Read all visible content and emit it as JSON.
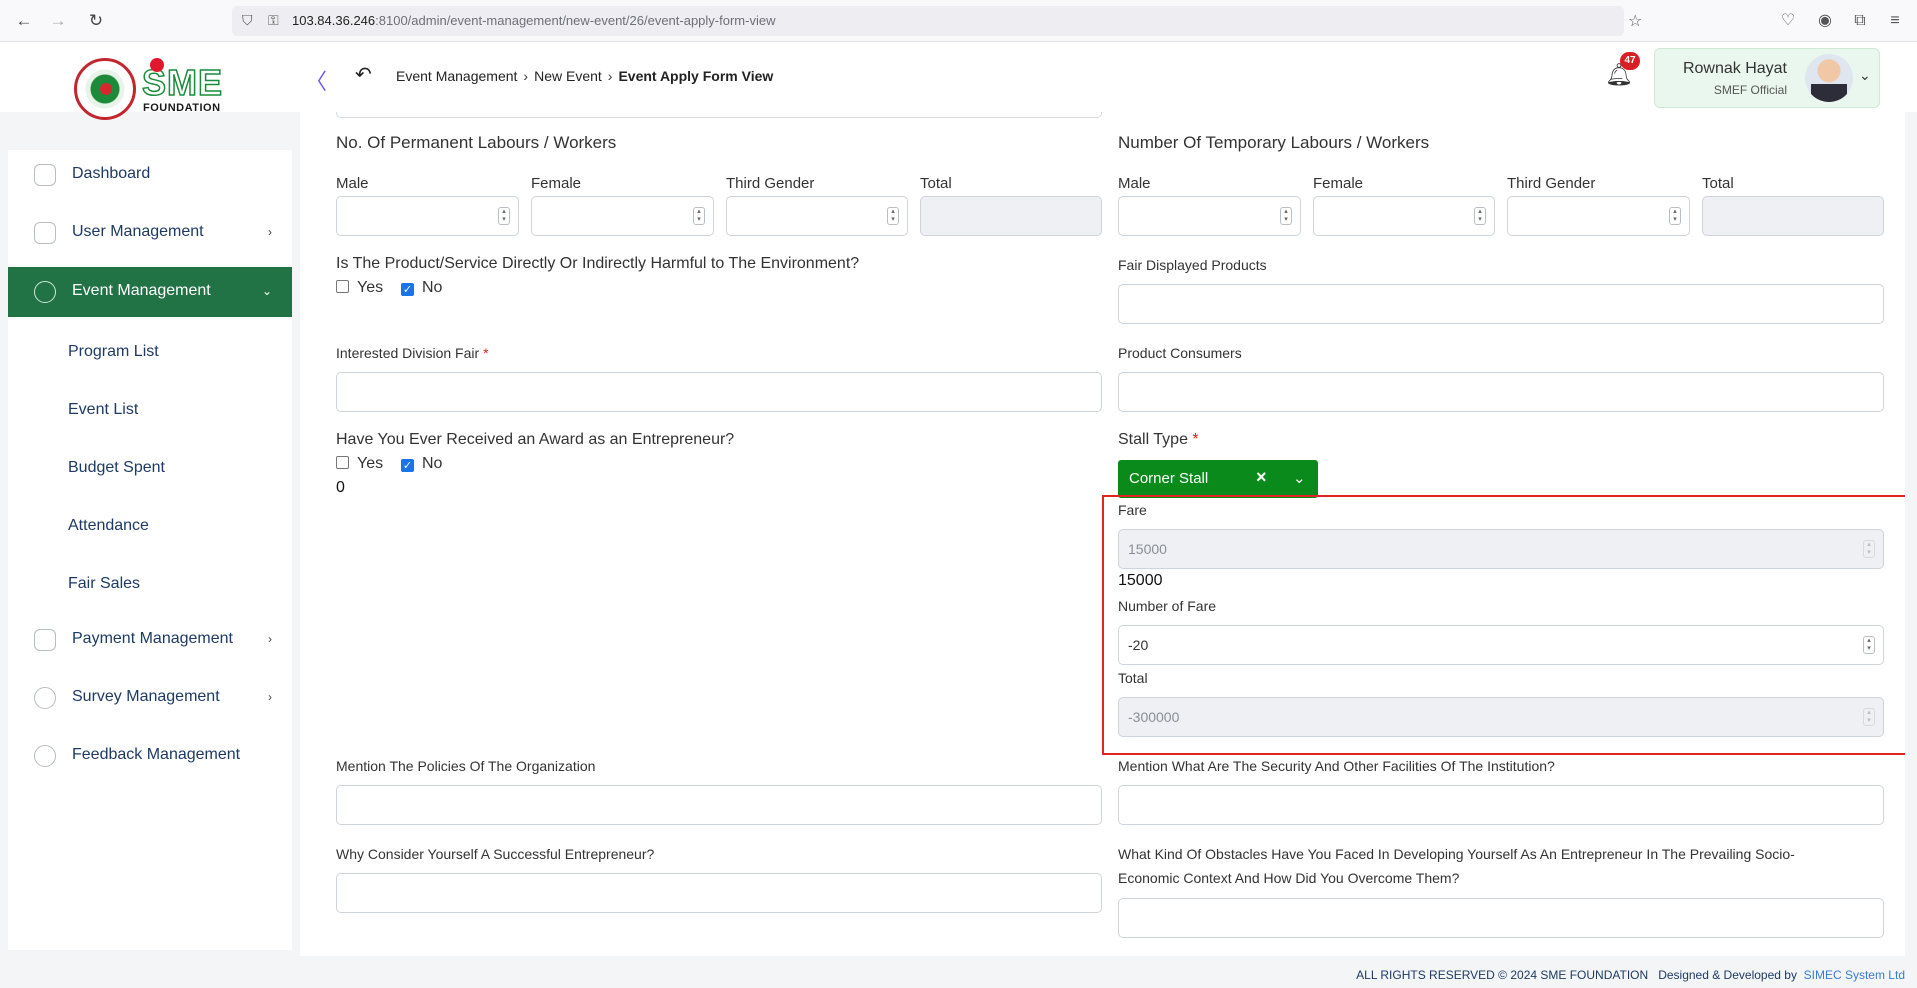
{
  "browser": {
    "url_host": "103.84.36.246",
    "url_rest": ":8100/admin/event-management/new-event/26/event-apply-form-view"
  },
  "header": {
    "logo_text_sme": "SME",
    "logo_text_foundation": "FOUNDATION",
    "breadcrumb": [
      "Event Management",
      "New Event",
      "Event Apply Form View"
    ],
    "notification_count": "47",
    "user_name": "Rownak Hayat",
    "user_role": "SMEF Official"
  },
  "sidebar": {
    "items": [
      {
        "label": "Dashboard",
        "icon": "dashboard-icon"
      },
      {
        "label": "User Management",
        "icon": "user-shield-icon"
      },
      {
        "label": "Event Management",
        "icon": "lock-icon"
      },
      {
        "label": "Payment Management",
        "icon": "money-icon"
      },
      {
        "label": "Survey Management",
        "icon": "pie-chart-icon"
      },
      {
        "label": "Feedback Management",
        "icon": "feedback-icon"
      }
    ],
    "sub_items": [
      "Program List",
      "Event List",
      "Budget Spent",
      "Attendance",
      "Fair Sales"
    ]
  },
  "form": {
    "permanent_title": "No. Of Permanent Labours / Workers",
    "temporary_title": "Number Of Temporary Labours / Workers",
    "gender_labels": [
      "Male",
      "Female",
      "Third Gender",
      "Total"
    ],
    "harmful_question": "Is The Product/Service Directly Or Indirectly Harmful to The Environment?",
    "yes": "Yes",
    "no": "No",
    "fair_displayed_products": "Fair Displayed Products",
    "interested_division_fair": "Interested Division Fair",
    "required_mark": "*",
    "product_consumers": "Product Consumers",
    "award_question": "Have You Ever Received an Award as an Entrepreneur?",
    "award_value": "0",
    "stall_type": "Stall Type",
    "stall_selected": "Corner Stall",
    "fare_label": "Fare",
    "fare_value": "15000",
    "fare_text": "15000",
    "number_of_fare_label": "Number of Fare",
    "number_of_fare_value": "-20",
    "total_label": "Total",
    "total_value": "-300000",
    "policies": "Mention The Policies Of The Organization",
    "security": "Mention What Are The Security And Other Facilities Of The Institution?",
    "successful": "Why Consider Yourself A Successful Entrepreneur?",
    "obstacles_line1": "What Kind Of Obstacles Have You Faced In Developing Yourself As An Entrepreneur In The Prevailing Socio-",
    "obstacles_line2": "Economic Context And How Did You Overcome Them?"
  },
  "footer": {
    "rights": "ALL RIGHTS RESERVED © 2024 SME FOUNDATION",
    "designed": "Designed & Developed by",
    "company": "SIMEC System Ltd"
  }
}
